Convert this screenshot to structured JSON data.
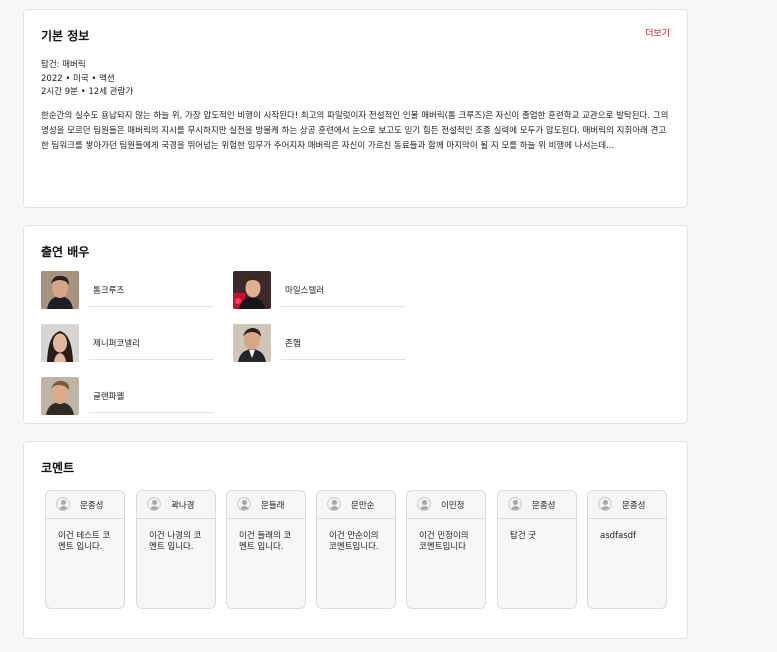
{
  "info": {
    "title": "기본 정보",
    "more_label": "더보기",
    "movie_title": "탑건: 매버릭",
    "meta_line": "2022 • 미국 • 액션",
    "runtime_line": "2시간 9분 • 12세 관람가",
    "synopsis": "한순간의 실수도 용납되지 않는 하늘 위, 가장 압도적인 비행이 시작된다! 최고의 파일럿이자 전설적인 인물 매버릭(톰 크루즈)은 자신이 졸업한 훈련학교 교관으로 발탁된다. 그의 명성을 모르던 팀원들은 매버릭의 지시를 무시하지만 실전을 방불케 하는 상공 훈련에서 눈으로 보고도 믿기 힘든 전설적인 조종 실력에 모두가 압도된다. 매버릭의 지휘아래 견고한 팀워크를 쌓아가던 팀원들에게 국경을 뛰어넘는 위험한 임무가 주어지자 매버릭은 자신이 가르친 동료들과 함께 마지막이 될 지 모를 하늘 위 비행에 나서는데..."
  },
  "cast": {
    "title": "출연 배우",
    "actors": [
      {
        "name": "톰크루즈"
      },
      {
        "name": "마일스텔러"
      },
      {
        "name": "제니퍼코넬리"
      },
      {
        "name": "존햄"
      },
      {
        "name": "글렌파웰"
      }
    ]
  },
  "comments": {
    "title": "코멘트",
    "items": [
      {
        "author": "문종성",
        "text": "이건 테스트 코멘트 입니다."
      },
      {
        "author": "곽나경",
        "text": "이건 나경의 코멘트 입니다."
      },
      {
        "author": "문들래",
        "text": "이건 들래의 코멘트 입니다."
      },
      {
        "author": "문만순",
        "text": "이건 만순이의 코멘트입니다."
      },
      {
        "author": "이민정",
        "text": "이건 민정이의 코멘트입니다"
      },
      {
        "author": "문종성",
        "text": "탑건 굿"
      },
      {
        "author": "문종성",
        "text": "asdfasdf"
      }
    ]
  },
  "colors": {
    "accent": "#d0181f",
    "background": "#f7f7f7",
    "card": "#ffffff"
  },
  "icons": {
    "comment_avatar": "user-avatar-icon"
  }
}
